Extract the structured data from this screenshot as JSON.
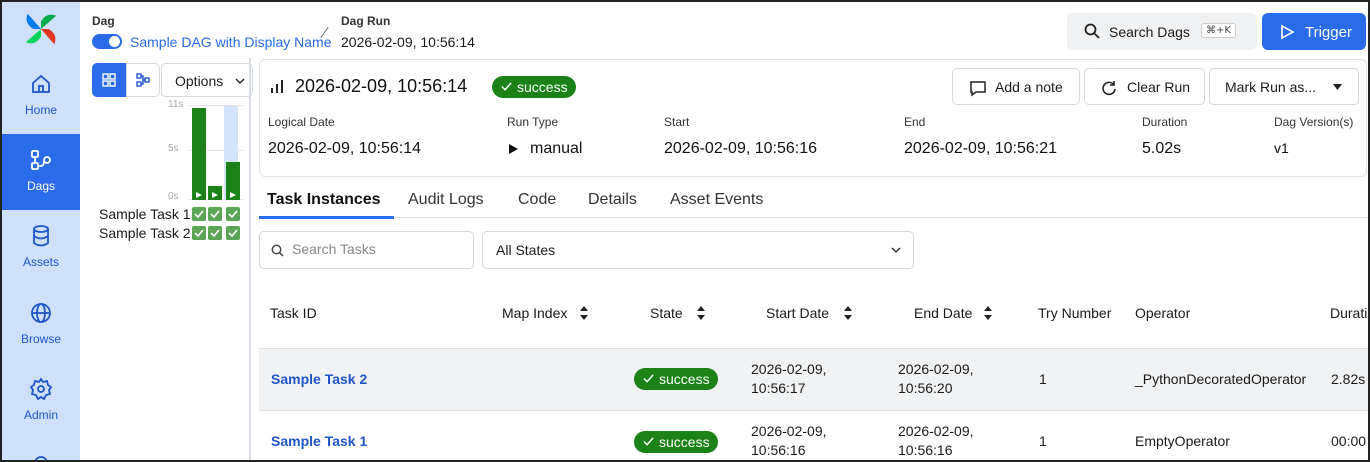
{
  "colors": {
    "accent": "#2a6be9",
    "success": "#1a8216",
    "nav_bg": "#cfe0fb"
  },
  "nav": {
    "items": [
      {
        "label": "Home",
        "icon": "home-icon"
      },
      {
        "label": "Dags",
        "icon": "dags-icon",
        "active": true
      },
      {
        "label": "Assets",
        "icon": "database-icon"
      },
      {
        "label": "Browse",
        "icon": "globe-icon"
      },
      {
        "label": "Admin",
        "icon": "gear-icon"
      }
    ]
  },
  "breadcrumb": {
    "dag_label": "Dag",
    "dag_name": "Sample DAG with Display Name",
    "run_label": "Dag Run",
    "run_value": "2026-02-09, 10:56:14"
  },
  "header": {
    "search_label": "Search Dags",
    "search_shortcut": "⌘+K",
    "trigger_label": "Trigger"
  },
  "grid": {
    "view_options_label": "Options",
    "y_ticks": [
      "11s",
      "5s",
      "0s"
    ],
    "run_durations_s": [
      10.8,
      1.6,
      4.4
    ],
    "tasks": [
      {
        "name": "Sample Task 1",
        "states": [
          "success",
          "success",
          "success"
        ]
      },
      {
        "name": "Sample Task 2",
        "states": [
          "success",
          "success",
          "success"
        ]
      }
    ]
  },
  "run": {
    "title": "2026-02-09, 10:56:14",
    "state": "success",
    "actions": {
      "add_note": "Add a note",
      "clear_run": "Clear Run",
      "mark_run": "Mark Run as..."
    },
    "meta": {
      "logical_date_label": "Logical Date",
      "logical_date": "2026-02-09, 10:56:14",
      "run_type_label": "Run Type",
      "run_type": "manual",
      "start_label": "Start",
      "start": "2026-02-09, 10:56:16",
      "end_label": "End",
      "end": "2026-02-09, 10:56:21",
      "duration_label": "Duration",
      "duration": "5.02s",
      "version_label": "Dag Version(s)",
      "version": "v1"
    }
  },
  "tabs": [
    "Task Instances",
    "Audit Logs",
    "Code",
    "Details",
    "Asset Events"
  ],
  "filters": {
    "search_placeholder": "Search Tasks",
    "states_value": "All States"
  },
  "table": {
    "columns": [
      "Task ID",
      "Map Index",
      "State",
      "Start Date",
      "End Date",
      "Try Number",
      "Operator",
      "Durati"
    ],
    "rows": [
      {
        "task_id": "Sample Task 2",
        "state": "success",
        "start_1": "2026-02-09,",
        "start_2": "10:56:17",
        "end_1": "2026-02-09,",
        "end_2": "10:56:20",
        "try": "1",
        "operator": "_PythonDecoratedOperator",
        "duration": "2.82s"
      },
      {
        "task_id": "Sample Task 1",
        "state": "success",
        "start_1": "2026-02-09,",
        "start_2": "10:56:16",
        "end_1": "2026-02-09,",
        "end_2": "10:56:16",
        "try": "1",
        "operator": "EmptyOperator",
        "duration": "00:00"
      }
    ]
  }
}
